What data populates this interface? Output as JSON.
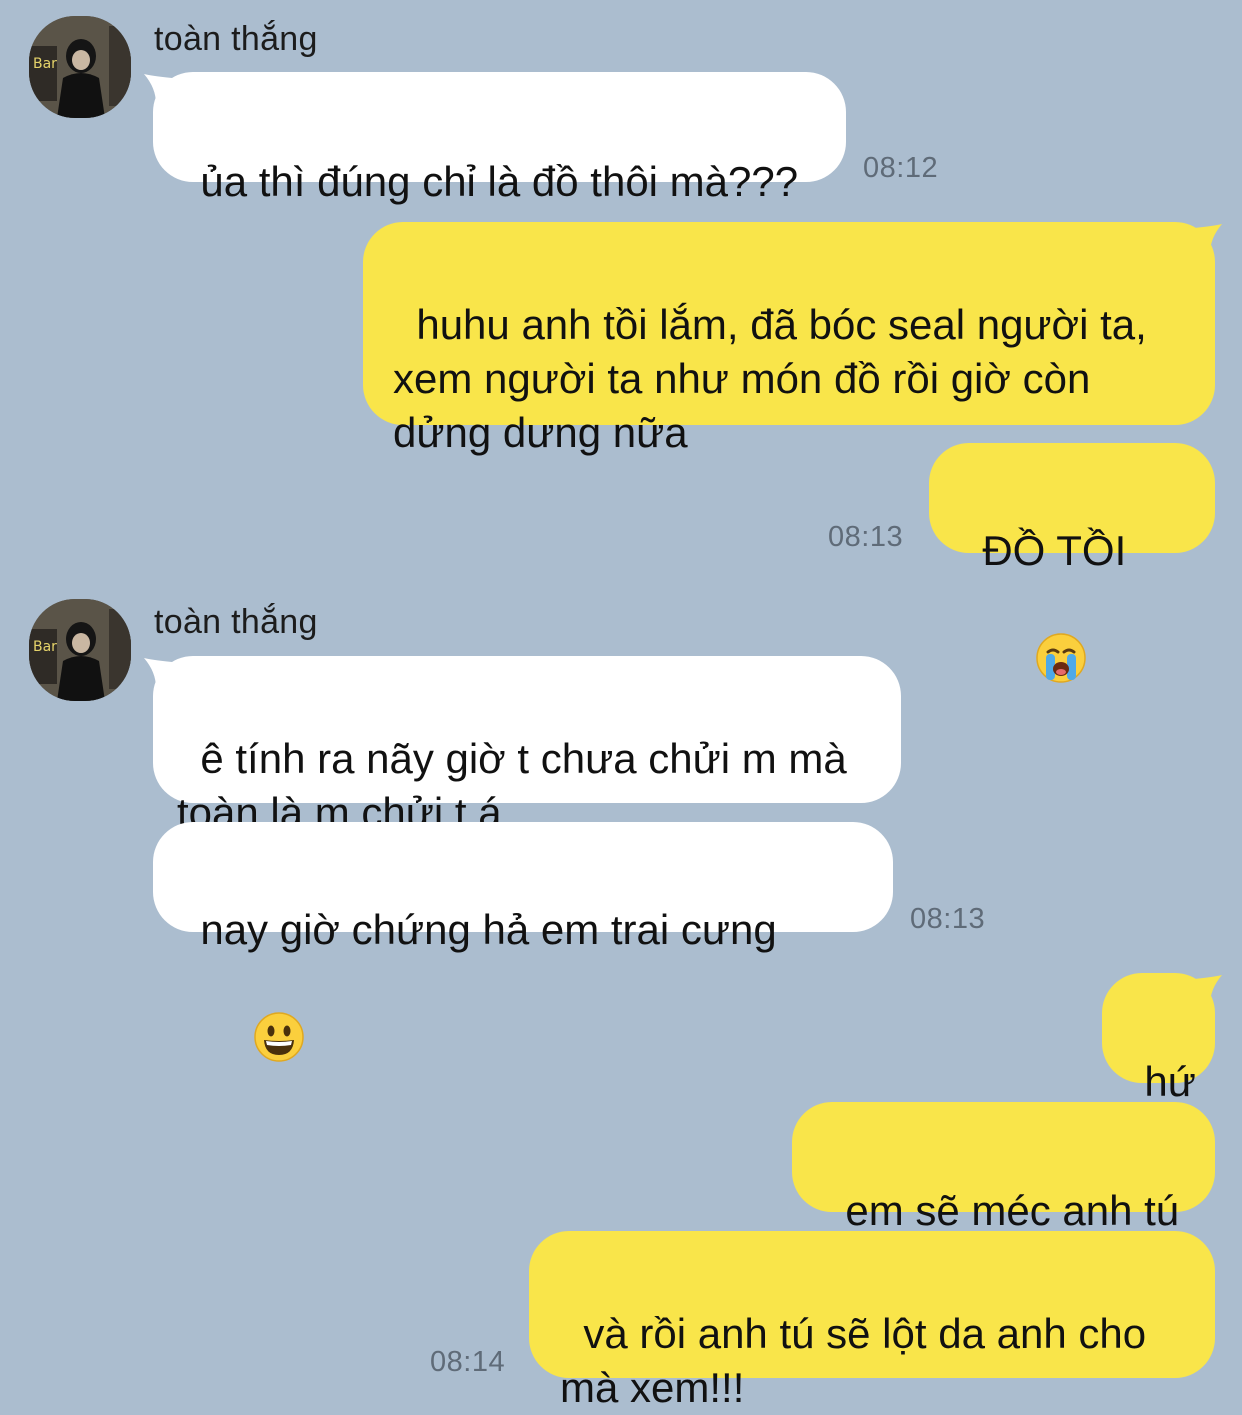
{
  "conversation": {
    "contact_name": "toàn thắng",
    "messages": [
      {
        "from": "them",
        "text": "ủa thì đúng chỉ là đồ thôi mà???",
        "time": "08:12"
      },
      {
        "from": "me",
        "text": "huhu anh tồi lắm, đã bóc seal người ta,\nxem người ta như món đồ rồi giờ còn\ndửng dưng nữa"
      },
      {
        "from": "me",
        "text": "ĐỒ TỒI",
        "emoji": "loudly-crying-face-icon",
        "time": "08:13"
      },
      {
        "from": "them",
        "text": "ê tính ra nãy giờ t chưa chửi m mà\ntoàn là m chửi t á"
      },
      {
        "from": "them",
        "text": "nay giờ chứng hả em trai cưng",
        "emoji": "grinning-face-icon",
        "time": "08:13"
      },
      {
        "from": "me",
        "text": "hứ"
      },
      {
        "from": "me",
        "text": "em sẽ méc anh tú"
      },
      {
        "from": "me",
        "text": "và rồi anh tú sẽ lột da anh cho\nmà xem!!!",
        "time": "08:14"
      }
    ]
  },
  "colors": {
    "background": "#abbdcf",
    "incoming_bubble": "#ffffff",
    "outgoing_bubble": "#f9e54a",
    "timestamp": "#5f6b78"
  }
}
